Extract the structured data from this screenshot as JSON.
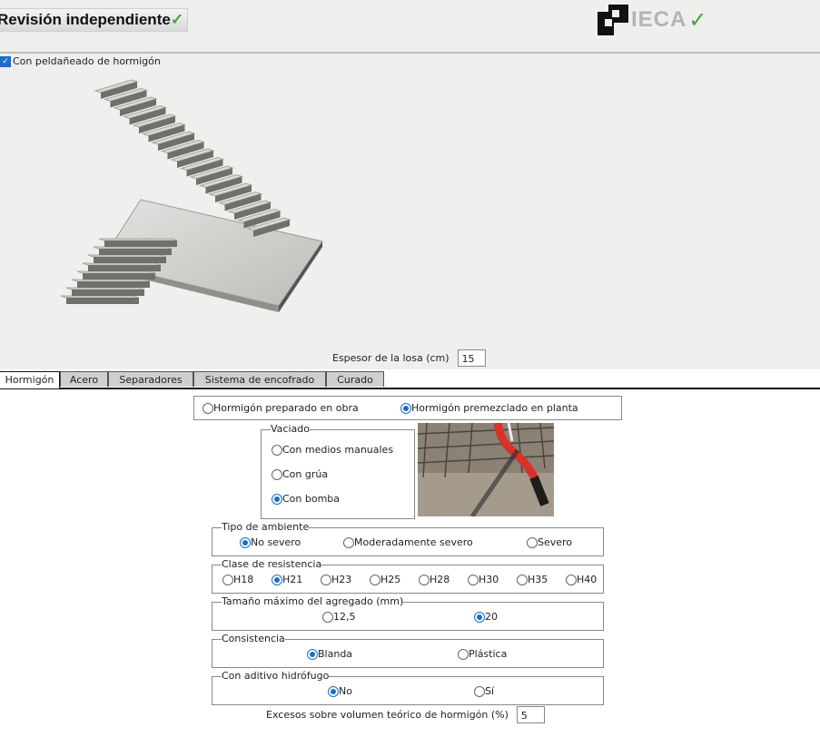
{
  "header": {
    "title": "Revisión independiente",
    "logo_text": "IECA",
    "check_glyph": "✓"
  },
  "options": {
    "concrete_steps_label": "Con peldañeado de hormigón",
    "concrete_steps_checked": true
  },
  "slab": {
    "label": "Espesor de la losa (cm)",
    "value": "15"
  },
  "tabs": [
    {
      "label": "Hormigón",
      "active": true
    },
    {
      "label": "Acero"
    },
    {
      "label": "Separadores"
    },
    {
      "label": "Sistema de encofrado"
    },
    {
      "label": "Curado"
    }
  ],
  "concrete_source": {
    "options": [
      "Hormigón preparado en obra",
      "Hormigón premezclado en planta"
    ],
    "selected": 1
  },
  "pouring": {
    "legend": "Vaciado",
    "options": [
      "Con medios manuales",
      "Con grúa",
      "Con bomba"
    ],
    "selected": 2
  },
  "environment": {
    "legend": "Tipo de ambiente",
    "options": [
      "No severo",
      "Moderadamente severo",
      "Severo"
    ],
    "selected": 0
  },
  "strength": {
    "legend": "Clase de resistencia",
    "options": [
      "H18",
      "H21",
      "H23",
      "H25",
      "H28",
      "H30",
      "H35",
      "H40"
    ],
    "selected": 1
  },
  "aggregate": {
    "legend": "Tamaño máximo del agregado (mm)",
    "options": [
      "12,5",
      "20"
    ],
    "selected": 1
  },
  "consistency": {
    "legend": "Consistencia",
    "options": [
      "Blanda",
      "Plástica"
    ],
    "selected": 0
  },
  "waterproof": {
    "legend": "Con aditivo hidrófugo",
    "options": [
      "No",
      "Sí"
    ],
    "selected": 0
  },
  "excess": {
    "label": "Excesos sobre volumen teórico de hormigón (%)",
    "value": "5"
  }
}
